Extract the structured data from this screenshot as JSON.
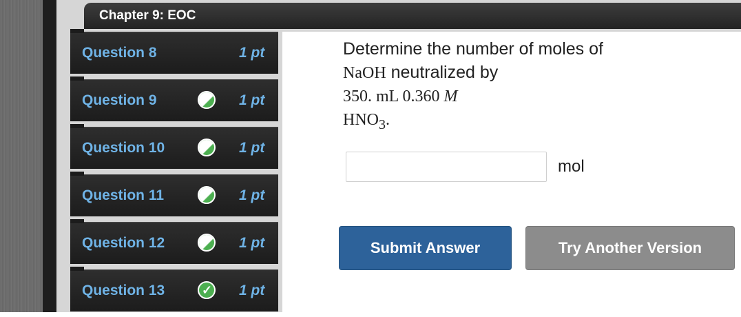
{
  "chapter": {
    "title": "Chapter 9: EOC"
  },
  "questions": [
    {
      "label": "Question 8",
      "points": "1 pt",
      "status": "unanswered"
    },
    {
      "label": "Question 9",
      "points": "1 pt",
      "status": "partial"
    },
    {
      "label": "Question 10",
      "points": "1 pt",
      "status": "partial"
    },
    {
      "label": "Question 11",
      "points": "1 pt",
      "status": "partial"
    },
    {
      "label": "Question 12",
      "points": "1 pt",
      "status": "partial"
    },
    {
      "label": "Question 13",
      "points": "1 pt",
      "status": "correct"
    }
  ],
  "question": {
    "line1": "Determine the number of moles of",
    "compound1": "NaOH",
    "line2": "neutralized by",
    "volume": "350. mL 0.360",
    "molarity_unit": "M",
    "acid": "HNO",
    "acid_sub": "3",
    "period": "."
  },
  "answer": {
    "value": "",
    "placeholder": "",
    "unit": "mol"
  },
  "buttons": {
    "submit": "Submit Answer",
    "try_another": "Try Another Version"
  },
  "colors": {
    "link_blue": "#6fb3e6",
    "submit_blue": "#2d629a",
    "try_gray": "#8c8c8c",
    "check_green": "#4caf50"
  }
}
